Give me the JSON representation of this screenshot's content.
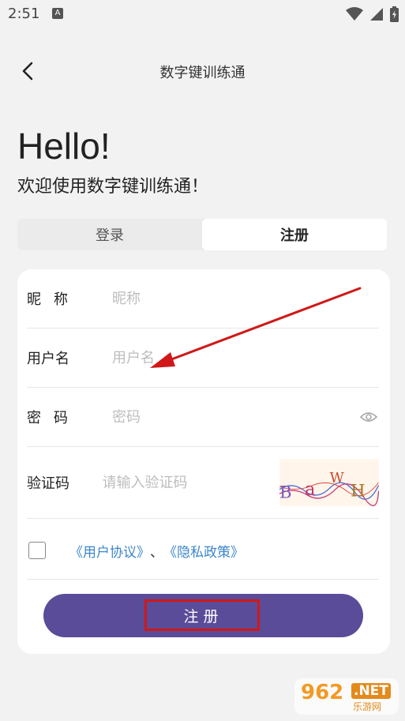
{
  "status": {
    "time": "2:51",
    "notif": "A"
  },
  "header": {
    "title": "数字键训练通"
  },
  "hero": {
    "hello": "Hello!",
    "welcome": "欢迎使用数字键训练通！"
  },
  "tabs": [
    {
      "label": "登录",
      "active": false
    },
    {
      "label": "注册",
      "active": true
    }
  ],
  "form": {
    "nickname": {
      "label": "昵称",
      "placeholder": "昵称",
      "value": ""
    },
    "username": {
      "label": "用户名",
      "placeholder": "用户名",
      "value": ""
    },
    "password": {
      "label": "密码",
      "placeholder": "密码",
      "value": ""
    },
    "captcha": {
      "label": "验证码",
      "placeholder": "请输入验证码",
      "value": "",
      "image_text": [
        "B",
        "a",
        "W",
        "H"
      ]
    },
    "agree": {
      "checked": false,
      "user_agreement": "《用户协议》",
      "separator": "、",
      "privacy_policy": "《隐私政策》"
    },
    "submit_label": "注册"
  },
  "colors": {
    "primary": "#5a4c99",
    "link": "#3c86c9",
    "annotation": "#d01818",
    "background": "#f2f2f2"
  },
  "watermark": {
    "number": "962",
    "suffix": ".NET",
    "sub": "乐游网"
  }
}
